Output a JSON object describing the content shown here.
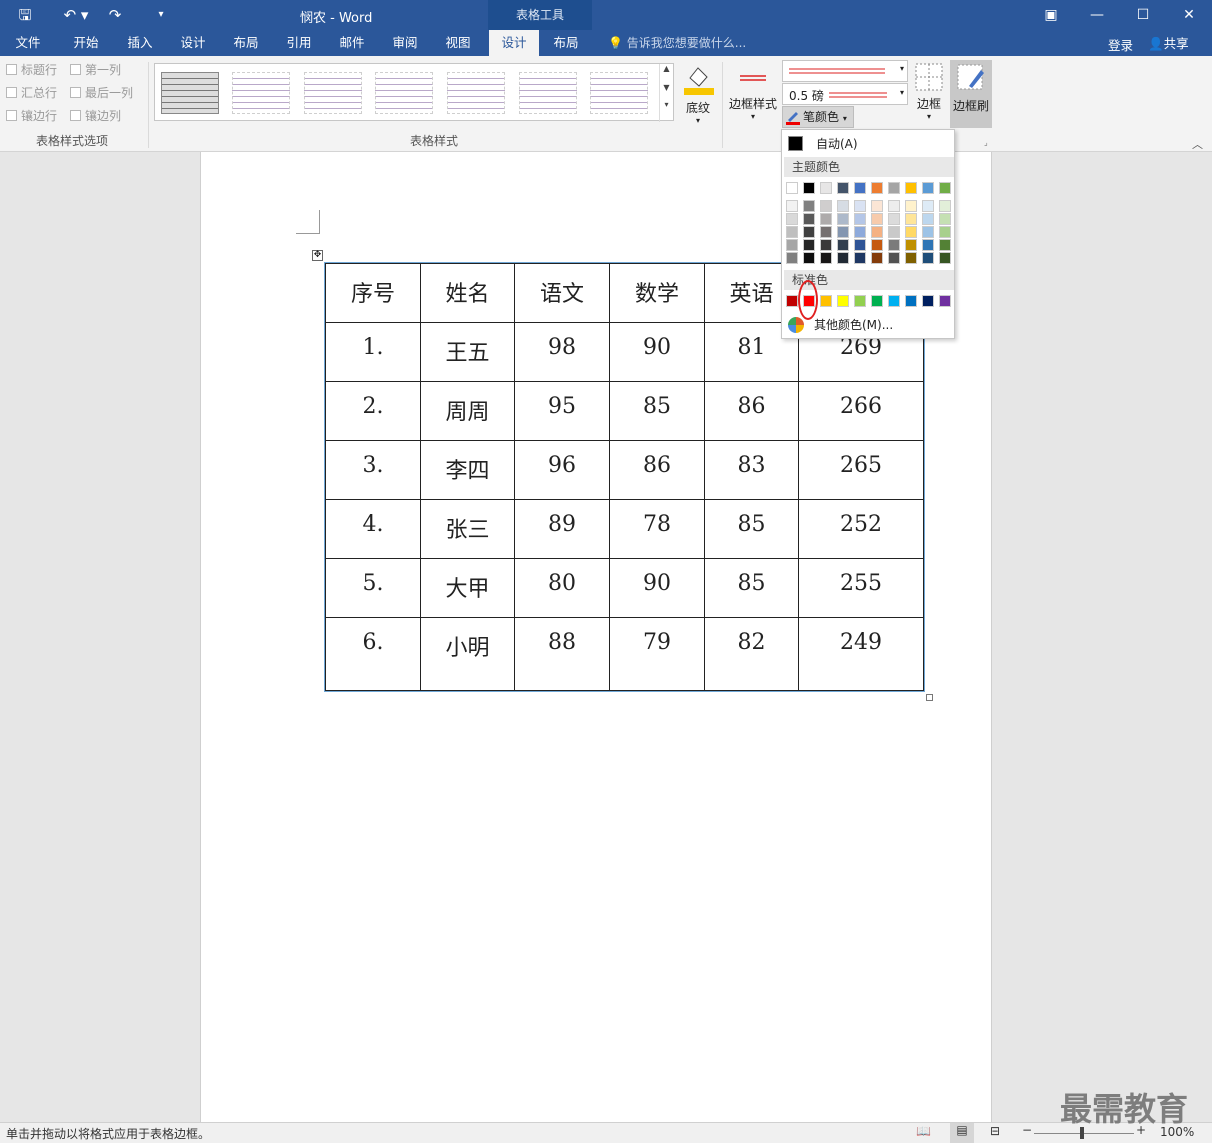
{
  "titlebar": {
    "title": "悯农 - Word",
    "contextual_group": "表格工具",
    "qa_save": "🖫",
    "qa_undo": "↶ ▾",
    "qa_redo": "↷",
    "qa_customize": "▾",
    "win_ribbon": "▣",
    "win_min": "—",
    "win_max": "☐",
    "win_close": "✕"
  },
  "tabs": [
    "文件",
    "开始",
    "插入",
    "设计",
    "布局",
    "引用",
    "邮件",
    "审阅",
    "视图",
    "设计",
    "布局"
  ],
  "tell_me": "告诉我您想要做什么...",
  "account": {
    "login": "登录",
    "share": "共享"
  },
  "ribbon": {
    "table_style_options": {
      "label": "表格样式选项",
      "checkboxes": [
        "标题行",
        "第一列",
        "汇总行",
        "最后一列",
        "镶边行",
        "镶边列"
      ]
    },
    "table_styles_label": "表格样式",
    "shading": "底纹",
    "border_styles": "边框样式",
    "pen_weight": "0.5 磅",
    "pen_color": "笔颜色",
    "borders": "边框",
    "border_painter": "边框刷"
  },
  "color_popup": {
    "auto": "自动(A)",
    "theme_colors": "主题颜色",
    "standard_colors": "标准色",
    "more_colors": "其他颜色(M)...",
    "theme_top": [
      "#ffffff",
      "#000000",
      "#e7e6e6",
      "#44546a",
      "#4472c4",
      "#ed7d31",
      "#a5a5a5",
      "#ffc000",
      "#5b9bd5",
      "#70ad47"
    ],
    "theme_shades": [
      [
        "#f2f2f2",
        "#808080",
        "#d0cece",
        "#d6dce4",
        "#d9e2f3",
        "#fbe5d5",
        "#ededed",
        "#fff2cc",
        "#deebf6",
        "#e2efd9"
      ],
      [
        "#d9d9d9",
        "#595959",
        "#aeabab",
        "#adb9ca",
        "#b4c6e7",
        "#f7cbac",
        "#dbdbdb",
        "#fee599",
        "#bdd7ee",
        "#c5e0b3"
      ],
      [
        "#bfbfbf",
        "#404040",
        "#757070",
        "#8496b0",
        "#8eaadb",
        "#f4b183",
        "#c9c9c9",
        "#ffd965",
        "#9dc3e6",
        "#a8d08d"
      ],
      [
        "#a6a6a6",
        "#262626",
        "#3a3838",
        "#323f4f",
        "#2f5496",
        "#c55a11",
        "#7b7b7b",
        "#bf9000",
        "#2e75b5",
        "#538135"
      ],
      [
        "#808080",
        "#0d0d0d",
        "#171616",
        "#222a35",
        "#1f3864",
        "#843c0b",
        "#525252",
        "#7f6000",
        "#1f4e79",
        "#375623"
      ]
    ],
    "standard": [
      "#c00000",
      "#ff0000",
      "#ffc000",
      "#ffff00",
      "#92d050",
      "#00b050",
      "#00b0f0",
      "#0070c0",
      "#002060",
      "#7030a0"
    ]
  },
  "table": {
    "headers": [
      "序号",
      "姓名",
      "语文",
      "数学",
      "英语",
      ""
    ],
    "rows": [
      [
        "1.",
        "王五",
        "98",
        "90",
        "81",
        "269"
      ],
      [
        "2.",
        "周周",
        "95",
        "85",
        "86",
        "266"
      ],
      [
        "3.",
        "李四",
        "96",
        "86",
        "83",
        "265"
      ],
      [
        "4.",
        "张三",
        "89",
        "78",
        "85",
        "252"
      ],
      [
        "5.",
        "大甲",
        "80",
        "90",
        "85",
        "255"
      ],
      [
        "6.",
        "小明",
        "88",
        "79",
        "82",
        "249"
      ]
    ]
  },
  "status": {
    "message": "单击并拖动以将格式应用于表格边框。",
    "zoom": "100%"
  },
  "watermark": "最需教育"
}
